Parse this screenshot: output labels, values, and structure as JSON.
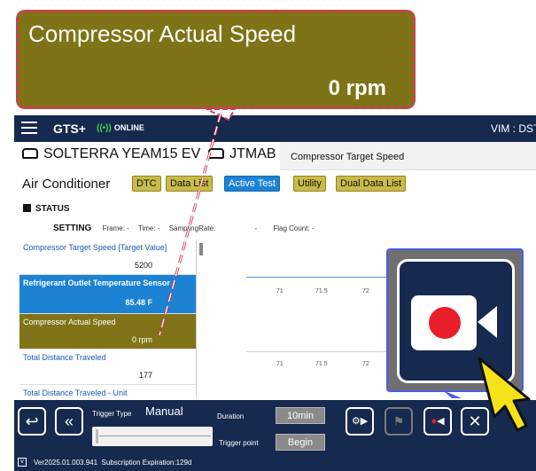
{
  "topbar": {
    "brand": "GTS+",
    "online_label": "ONLINE",
    "vim": "VIM : DST-i"
  },
  "vehicle": {
    "model": "SOLTERRA YEAM15 EV",
    "vin_prefix": "JTMAB"
  },
  "tooltip": "Compressor Target Speed",
  "section": {
    "title": "Air Conditioner",
    "tabs": [
      "DTC",
      "Data List",
      "Active Test",
      "Utility",
      "Dual Data List"
    ],
    "active_tab_index": 2
  },
  "status": {
    "label": "STATUS",
    "setting": "SETTING",
    "frame": "Frame:  -",
    "time": "Time:  -",
    "sampling": "SamplingRate:",
    "sampling_val": "-",
    "flag": "Flag Count:  -"
  },
  "datalist": [
    {
      "label": "Compressor Target Speed [Target Value]",
      "value": "5200",
      "style": "normal"
    },
    {
      "label": "Refrigerant Outlet Temperature Sensor",
      "value": "85.48 F",
      "style": "selected"
    },
    {
      "label": "Compressor Actual Speed",
      "value": "0 rpm",
      "style": "olive"
    },
    {
      "label": "Total Distance Traveled",
      "value": "177",
      "style": "normal"
    },
    {
      "label": "Total Distance Traveled - Unit",
      "value": "",
      "style": "normal"
    }
  ],
  "graph": {
    "ticks_row1": [
      "71",
      "71.5",
      "72"
    ],
    "ticks_row2": [
      "71",
      "71.5",
      "72"
    ]
  },
  "toolbar": {
    "back_icon": "return-arrow-icon",
    "rewind_icon": "double-chevron-left-icon",
    "trigger_type_label": "Trigger Type",
    "trigger_type_value": "Manual",
    "duration_label": "Duration",
    "duration_value": "10min",
    "trigger_point_label": "Trigger point",
    "trigger_point_value": "Begin",
    "close_icon": "close-icon"
  },
  "footer": {
    "version": "Ver2025.01.003.941",
    "subscription": "Subscription Expiration:129d"
  },
  "callout": {
    "title": "Compressor Actual Speed",
    "value": "0 rpm"
  },
  "colors": {
    "nav": "#16294f",
    "olive": "#817418",
    "selected": "#1c82d4",
    "callout_border": "#d23a5a",
    "record_red": "#e81f2a",
    "online_green": "#3dd84a"
  }
}
